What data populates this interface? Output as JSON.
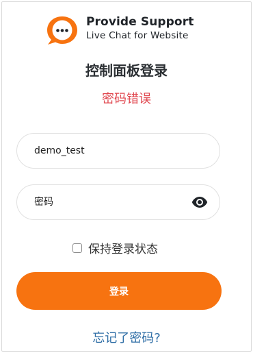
{
  "logo": {
    "name": "Provide Support",
    "tagline": "Live Chat for Website",
    "icon": "chat-bubble-icon",
    "accent": "#f77310"
  },
  "login": {
    "title": "控制面板登录",
    "error": "密码错误",
    "username_value": "demo_test",
    "password_placeholder": "密码",
    "show_password_icon": "eye-icon",
    "remember_label": "保持登录状态",
    "remember_checked": false,
    "submit_label": "登录",
    "forgot_label": "忘记了密码?"
  },
  "colors": {
    "primary": "#f77310",
    "error": "#e0474f",
    "link": "#2f6ea6"
  }
}
